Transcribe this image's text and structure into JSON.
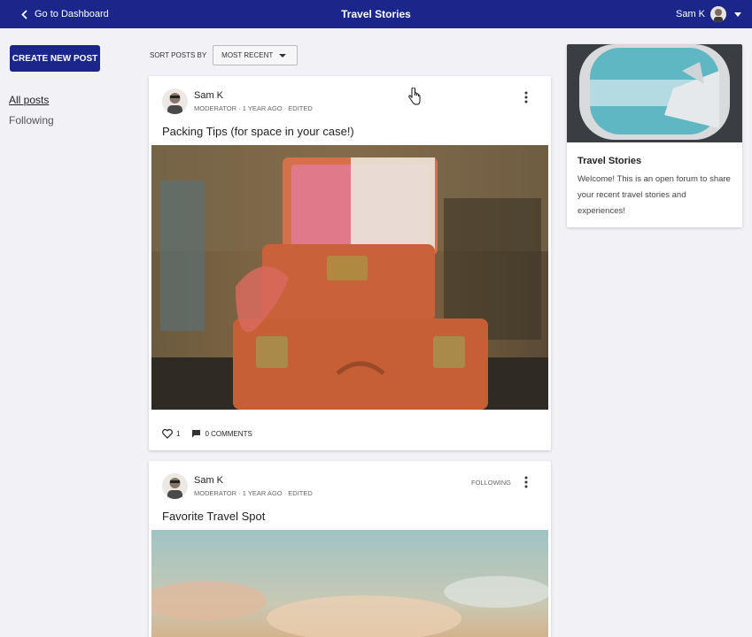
{
  "header": {
    "back_label": "Go to Dashboard",
    "title": "Travel Stories",
    "user_name": "Sam K"
  },
  "sidebar": {
    "create_button": "CREATE NEW POST",
    "nav": [
      {
        "label": "All posts",
        "active": true
      },
      {
        "label": "Following",
        "active": false
      }
    ]
  },
  "sort": {
    "label": "SORT POSTS BY",
    "selected": "MOST RECENT"
  },
  "posts": [
    {
      "author": "Sam K",
      "meta": "MODERATOR · 1 YEAR AGO · EDITED",
      "title": "Packing Tips (for space in your case!)",
      "likes": "1",
      "comments": "0 COMMENTS"
    },
    {
      "author": "Sam K",
      "meta": "MODERATOR · 1 YEAR AGO · EDITED",
      "following": "FOLLOWING",
      "title": "Favorite Travel Spot"
    }
  ],
  "about": {
    "title": "Travel Stories",
    "description": "Welcome! This is an open forum to share your recent travel stories and experiences!"
  },
  "colors": {
    "brand": "#1a2689",
    "page_bg": "#f2f1f5"
  }
}
